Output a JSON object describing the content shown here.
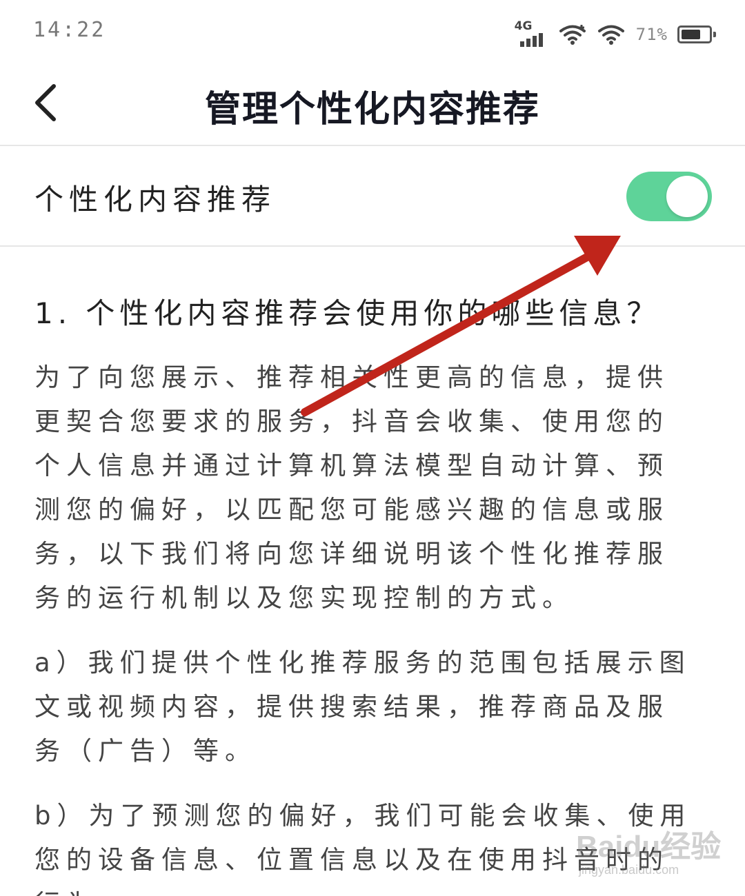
{
  "status_bar": {
    "time": "14:22",
    "network": "4G",
    "battery_percent": "71%",
    "battery_level": 0.71
  },
  "header": {
    "back_icon": "chevron-left-icon",
    "title": "管理个性化内容推荐"
  },
  "setting": {
    "label": "个性化内容推荐",
    "enabled": true,
    "accent_color": "#5ed399"
  },
  "content": {
    "heading": "1. 个性化内容推荐会使用你的哪些信息？",
    "paragraphs": [
      "为了向您展示、推荐相关性更高的信息，提供更契合您要求的服务，抖音会收集、使用您的个人信息并通过计算机算法模型自动计算、预测您的偏好，以匹配您可能感兴趣的信息或服务，以下我们将向您详细说明该个性化推荐服务的运行机制以及您实现控制的方式。",
      "a）我们提供个性化推荐服务的范围包括展示图文或视频内容，提供搜索结果，推荐商品及服务（广告）等。",
      "b）为了预测您的偏好，我们可能会收集、使用您的设备信息、位置信息以及在使用抖音时的行为"
    ]
  },
  "annotation": {
    "arrow_color": "#c0251b"
  },
  "watermark": {
    "brand": "Baidu经验",
    "url": "jingyan.baidu.com"
  }
}
